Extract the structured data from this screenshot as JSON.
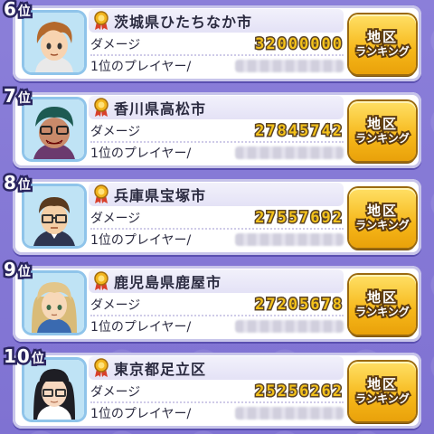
{
  "entries": [
    {
      "rank": "6",
      "rank_suffix": "位",
      "city": "茨城県ひたちなか市",
      "damage_label": "ダメージ",
      "damage": "32000000",
      "player_label": "1位のプレイヤー/",
      "button_line1": "地区",
      "button_line2": "ランキング",
      "avatar": "boy-brown-hair-avatar"
    },
    {
      "rank": "7",
      "rank_suffix": "位",
      "city": "香川県高松市",
      "damage_label": "ダメージ",
      "damage": "27845742",
      "player_label": "1位のプレイヤー/",
      "button_line1": "地区",
      "button_line2": "ランキング",
      "avatar": "angry-man-avatar"
    },
    {
      "rank": "8",
      "rank_suffix": "位",
      "city": "兵庫県宝塚市",
      "damage_label": "ダメージ",
      "damage": "27557692",
      "player_label": "1位のプレイヤー/",
      "button_line1": "地区",
      "button_line2": "ランキング",
      "avatar": "man-glasses-avatar"
    },
    {
      "rank": "9",
      "rank_suffix": "位",
      "city": "鹿児島県鹿屋市",
      "damage_label": "ダメージ",
      "damage": "27205678",
      "player_label": "1位のプレイヤー/",
      "button_line1": "地区",
      "button_line2": "ランキング",
      "avatar": "blonde-girl-avatar"
    },
    {
      "rank": "10",
      "rank_suffix": "位",
      "city": "東京都足立区",
      "damage_label": "ダメージ",
      "damage": "25256262",
      "player_label": "1位のプレイヤー/",
      "button_line1": "地区",
      "button_line2": "ランキング",
      "avatar": "girl-glasses-avatar"
    }
  ],
  "colors": {
    "background": "#8b7fd9",
    "damage_text": "#f4c21b",
    "button": "#f6b719",
    "avatar_border": "#8fc4ea"
  }
}
